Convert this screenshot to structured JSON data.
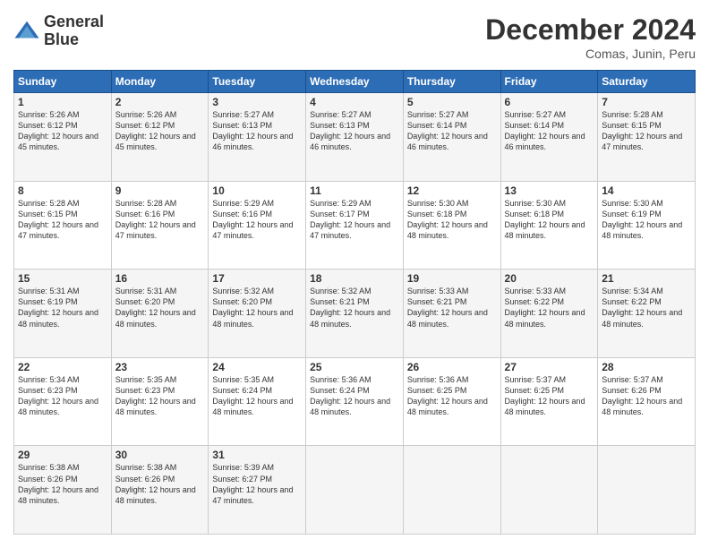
{
  "header": {
    "logo_line1": "General",
    "logo_line2": "Blue",
    "title": "December 2024",
    "subtitle": "Comas, Junin, Peru"
  },
  "calendar": {
    "days_of_week": [
      "Sunday",
      "Monday",
      "Tuesday",
      "Wednesday",
      "Thursday",
      "Friday",
      "Saturday"
    ],
    "weeks": [
      [
        null,
        {
          "day": "2",
          "sunrise": "5:26 AM",
          "sunset": "6:12 PM",
          "daylight": "12 hours and 45 minutes."
        },
        {
          "day": "3",
          "sunrise": "5:27 AM",
          "sunset": "6:13 PM",
          "daylight": "12 hours and 46 minutes."
        },
        {
          "day": "4",
          "sunrise": "5:27 AM",
          "sunset": "6:13 PM",
          "daylight": "12 hours and 46 minutes."
        },
        {
          "day": "5",
          "sunrise": "5:27 AM",
          "sunset": "6:14 PM",
          "daylight": "12 hours and 46 minutes."
        },
        {
          "day": "6",
          "sunrise": "5:27 AM",
          "sunset": "6:14 PM",
          "daylight": "12 hours and 46 minutes."
        },
        {
          "day": "7",
          "sunrise": "5:28 AM",
          "sunset": "6:15 PM",
          "daylight": "12 hours and 47 minutes."
        }
      ],
      [
        {
          "day": "1",
          "sunrise": "5:26 AM",
          "sunset": "6:12 PM",
          "daylight": "12 hours and 45 minutes."
        },
        null,
        null,
        null,
        null,
        null,
        null
      ],
      [
        {
          "day": "8",
          "sunrise": "5:28 AM",
          "sunset": "6:15 PM",
          "daylight": "12 hours and 47 minutes."
        },
        {
          "day": "9",
          "sunrise": "5:28 AM",
          "sunset": "6:16 PM",
          "daylight": "12 hours and 47 minutes."
        },
        {
          "day": "10",
          "sunrise": "5:29 AM",
          "sunset": "6:16 PM",
          "daylight": "12 hours and 47 minutes."
        },
        {
          "day": "11",
          "sunrise": "5:29 AM",
          "sunset": "6:17 PM",
          "daylight": "12 hours and 47 minutes."
        },
        {
          "day": "12",
          "sunrise": "5:30 AM",
          "sunset": "6:18 PM",
          "daylight": "12 hours and 48 minutes."
        },
        {
          "day": "13",
          "sunrise": "5:30 AM",
          "sunset": "6:18 PM",
          "daylight": "12 hours and 48 minutes."
        },
        {
          "day": "14",
          "sunrise": "5:30 AM",
          "sunset": "6:19 PM",
          "daylight": "12 hours and 48 minutes."
        }
      ],
      [
        {
          "day": "15",
          "sunrise": "5:31 AM",
          "sunset": "6:19 PM",
          "daylight": "12 hours and 48 minutes."
        },
        {
          "day": "16",
          "sunrise": "5:31 AM",
          "sunset": "6:20 PM",
          "daylight": "12 hours and 48 minutes."
        },
        {
          "day": "17",
          "sunrise": "5:32 AM",
          "sunset": "6:20 PM",
          "daylight": "12 hours and 48 minutes."
        },
        {
          "day": "18",
          "sunrise": "5:32 AM",
          "sunset": "6:21 PM",
          "daylight": "12 hours and 48 minutes."
        },
        {
          "day": "19",
          "sunrise": "5:33 AM",
          "sunset": "6:21 PM",
          "daylight": "12 hours and 48 minutes."
        },
        {
          "day": "20",
          "sunrise": "5:33 AM",
          "sunset": "6:22 PM",
          "daylight": "12 hours and 48 minutes."
        },
        {
          "day": "21",
          "sunrise": "5:34 AM",
          "sunset": "6:22 PM",
          "daylight": "12 hours and 48 minutes."
        }
      ],
      [
        {
          "day": "22",
          "sunrise": "5:34 AM",
          "sunset": "6:23 PM",
          "daylight": "12 hours and 48 minutes."
        },
        {
          "day": "23",
          "sunrise": "5:35 AM",
          "sunset": "6:23 PM",
          "daylight": "12 hours and 48 minutes."
        },
        {
          "day": "24",
          "sunrise": "5:35 AM",
          "sunset": "6:24 PM",
          "daylight": "12 hours and 48 minutes."
        },
        {
          "day": "25",
          "sunrise": "5:36 AM",
          "sunset": "6:24 PM",
          "daylight": "12 hours and 48 minutes."
        },
        {
          "day": "26",
          "sunrise": "5:36 AM",
          "sunset": "6:25 PM",
          "daylight": "12 hours and 48 minutes."
        },
        {
          "day": "27",
          "sunrise": "5:37 AM",
          "sunset": "6:25 PM",
          "daylight": "12 hours and 48 minutes."
        },
        {
          "day": "28",
          "sunrise": "5:37 AM",
          "sunset": "6:26 PM",
          "daylight": "12 hours and 48 minutes."
        }
      ],
      [
        {
          "day": "29",
          "sunrise": "5:38 AM",
          "sunset": "6:26 PM",
          "daylight": "12 hours and 48 minutes."
        },
        {
          "day": "30",
          "sunrise": "5:38 AM",
          "sunset": "6:26 PM",
          "daylight": "12 hours and 48 minutes."
        },
        {
          "day": "31",
          "sunrise": "5:39 AM",
          "sunset": "6:27 PM",
          "daylight": "12 hours and 47 minutes."
        },
        null,
        null,
        null,
        null
      ]
    ]
  }
}
